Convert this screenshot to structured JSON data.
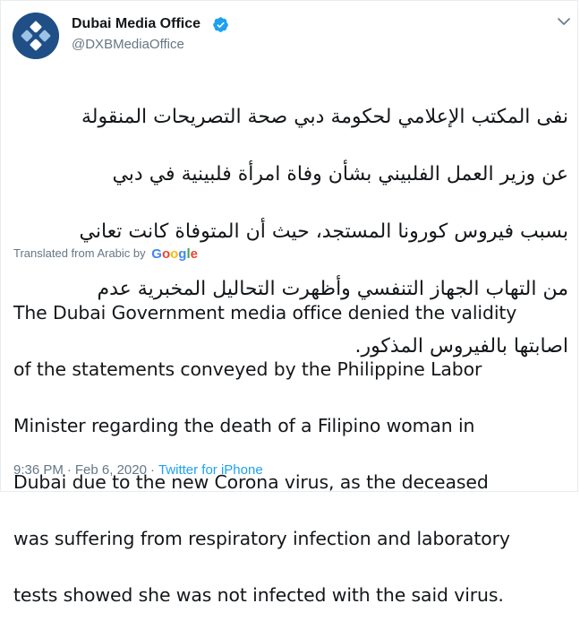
{
  "tweet": {
    "display_name": "Dubai Media Office",
    "handle": "@DXBMediaOffice",
    "arabic_lines": [
      "نفى المكتب الإعلامي لحكومة دبي صحة التصريحات المنقولة",
      "عن وزير العمل الفلبيني بشأن وفاة امرأة فلبينية في دبي",
      "بسبب فيروس كورونا المستجد، حيث أن المتوفاة كانت تعاني",
      "من التهاب الجهاز التنفسي وأظهرت التحاليل المخبرية عدم",
      "اصابتها بالفيروس المذكور."
    ],
    "translated_label": "Translated from Arabic by",
    "translator_brand": "Google",
    "english_lines": [
      "The Dubai Government media office denied the validity",
      "of the statements conveyed by the Philippine Labor",
      "Minister regarding the death of a Filipino woman in",
      "Dubai due to the new Corona virus, as the deceased",
      "was suffering from respiratory infection and laboratory",
      "tests showed she was not infected with the said virus."
    ],
    "time": "9:36 PM",
    "separator": "·",
    "date": "Feb 6, 2020",
    "source": "Twitter for iPhone"
  },
  "icons": {
    "avatar": "dubai-media-office-logo-icon",
    "verified": "verified-badge-icon",
    "menu": "chevron-down-icon"
  },
  "colors": {
    "text": "#14171a",
    "secondary": "#657786",
    "link": "#1da1f2",
    "verified": "#1da1f2",
    "avatar_bg": "#1f4f86",
    "google_blue": "#4285f4",
    "google_red": "#ea4335",
    "google_yellow": "#fbbc05",
    "google_green": "#34a853"
  }
}
